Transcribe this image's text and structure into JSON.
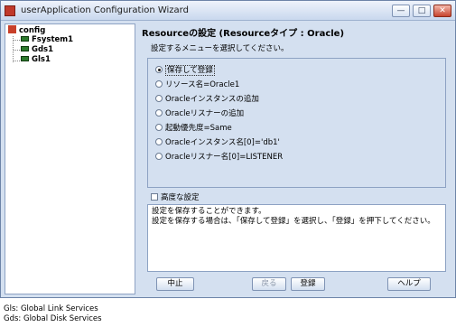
{
  "window": {
    "title": "userApplication Configuration Wizard",
    "controls": {
      "minimize": "—",
      "maximize": "□",
      "close": "✕"
    }
  },
  "tree": {
    "root": "config",
    "children": [
      "Fsystem1",
      "Gds1",
      "Gls1"
    ]
  },
  "panel": {
    "heading": "Resourceの設定 (Resourceタイプ : Oracle)",
    "subheading": "設定するメニューを選択してください。",
    "options": [
      {
        "label": "保存して登録",
        "selected": true
      },
      {
        "label": "リソース名=Oracle1",
        "selected": false
      },
      {
        "label": "Oracleインスタンスの追加",
        "selected": false
      },
      {
        "label": "Oracleリスナーの追加",
        "selected": false
      },
      {
        "label": "起動優先度=Same",
        "selected": false
      },
      {
        "label": "Oracleインスタンス名[0]='db1'",
        "selected": false
      },
      {
        "label": "Oracleリスナー名[0]=LISTENER",
        "selected": false
      }
    ],
    "advanced_label": "高度な設定",
    "description": [
      "設定を保存することができます。",
      "設定を保存する場合は、「保存して登録」を選択し、「登録」を押下してください。"
    ]
  },
  "buttons": {
    "cancel": "中止",
    "back": "戻る",
    "register": "登録",
    "help": "ヘルプ"
  },
  "footnotes": [
    "Gls: Global Link Services",
    "Gds: Global Disk Services"
  ]
}
